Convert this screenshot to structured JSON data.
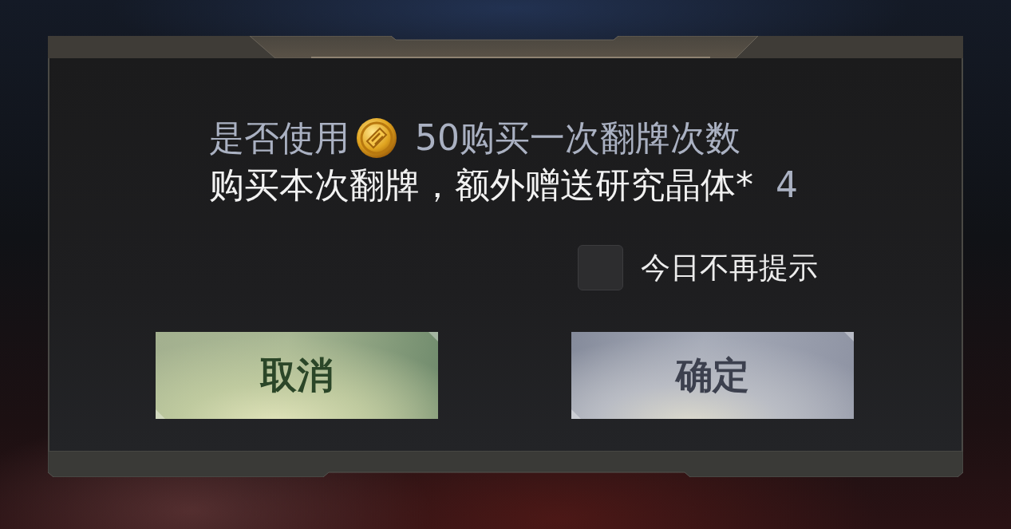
{
  "dialog": {
    "prompt": {
      "prefix": "是否使用",
      "amount": "50购买一次翻牌次数"
    },
    "bonus": {
      "text": "购买本次翻牌，额外赠送研究晶体*",
      "count": "4"
    },
    "checkbox": {
      "label": "今日不再提示",
      "checked": false
    },
    "buttons": [
      {
        "label": "取消",
        "kind": "cancel"
      },
      {
        "label": "确定",
        "kind": "confirm"
      }
    ]
  }
}
